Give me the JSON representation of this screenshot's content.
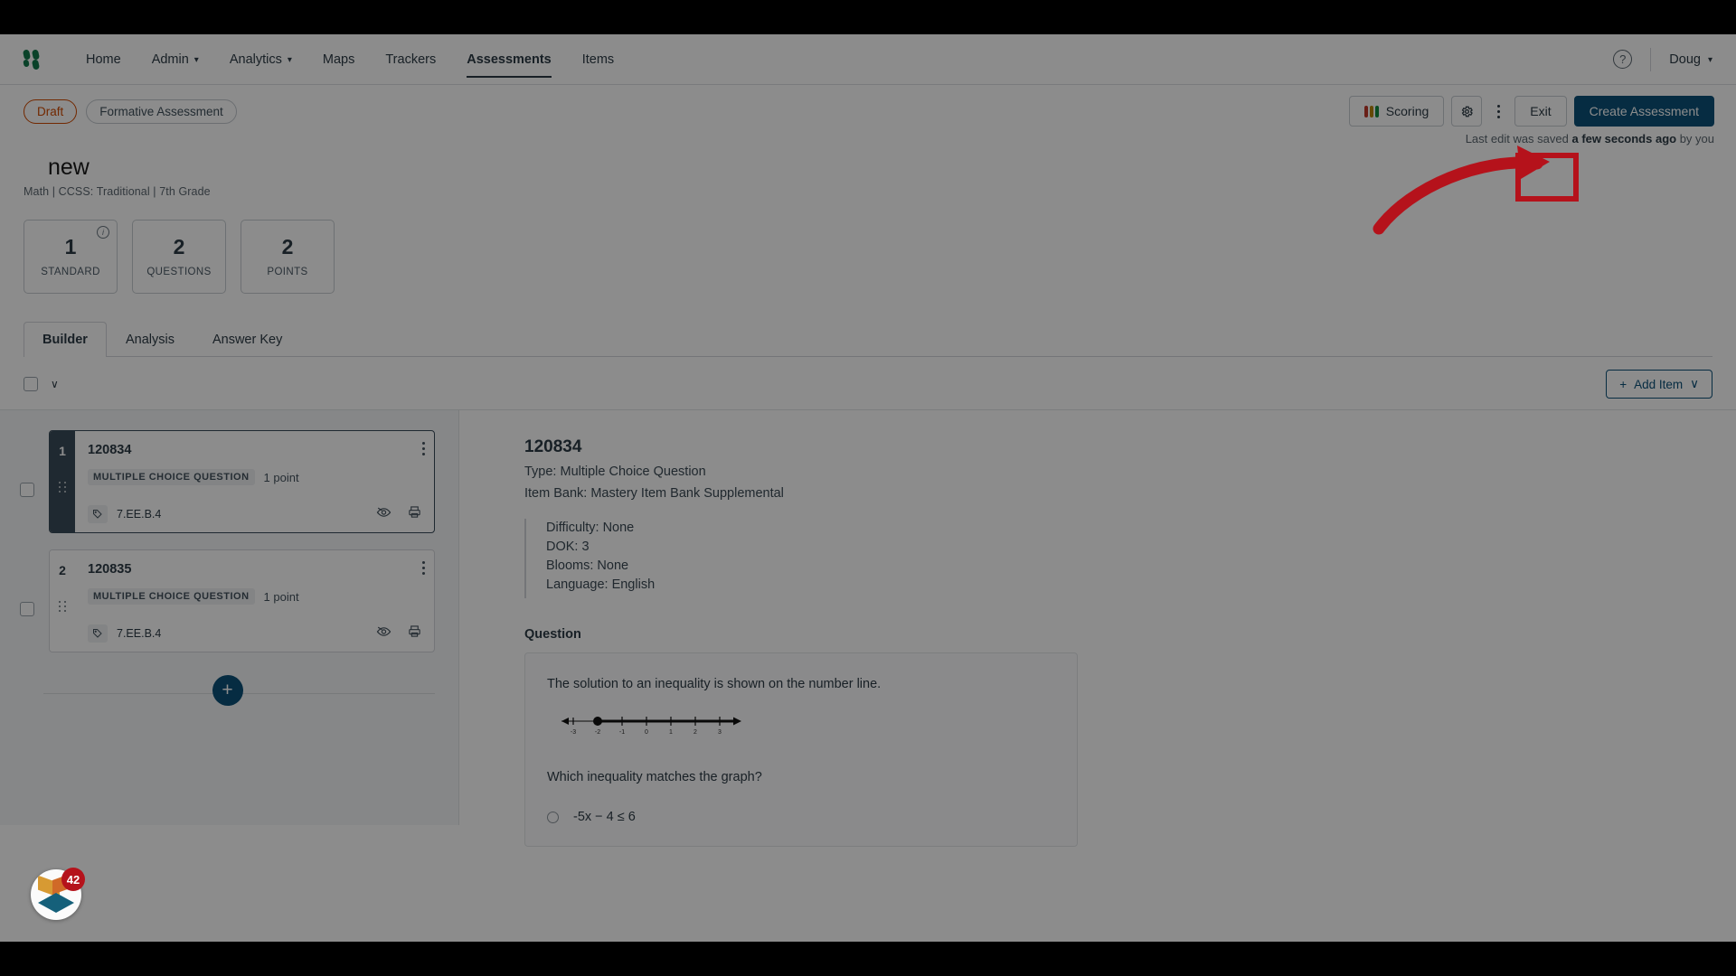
{
  "colors": {
    "accent": "#0b5078",
    "annotation": "#b5121b",
    "draft": "#cf4a00",
    "brand_green": "#13784b",
    "seal_purple": "#a3238e",
    "dark_rail": "#394b59"
  },
  "topnav": {
    "logo_name": "mastery-logo",
    "items": [
      {
        "label": "Home",
        "has_caret": false,
        "active": false
      },
      {
        "label": "Admin",
        "has_caret": true,
        "active": false
      },
      {
        "label": "Analytics",
        "has_caret": true,
        "active": false
      },
      {
        "label": "Maps",
        "has_caret": false,
        "active": false
      },
      {
        "label": "Trackers",
        "has_caret": false,
        "active": false
      },
      {
        "label": "Assessments",
        "has_caret": false,
        "active": true
      },
      {
        "label": "Items",
        "has_caret": false,
        "active": false
      }
    ],
    "help_label": "?",
    "user_label": "Doug",
    "user_caret": "∨"
  },
  "header": {
    "chips": [
      {
        "label": "Draft",
        "style": "draft"
      },
      {
        "label": "Formative Assessment",
        "style": "plain"
      }
    ],
    "actions": {
      "scoring_label": "Scoring",
      "settings_icon": "gear-icon",
      "kebab_icon": "more-vertical-icon",
      "exit_label": "Exit",
      "create_label": "Create Assessment"
    },
    "saved_prefix": "Last edit was saved ",
    "saved_strong": "a few seconds ago",
    "saved_suffix": " by you",
    "title": "new",
    "title_badge_icon": "verified-seal-icon",
    "subtitle": "Math  |  CCSS: Traditional  |  7th Grade"
  },
  "stats": [
    {
      "num": "1",
      "label": "STANDARD",
      "info": true,
      "info_icon": "info-icon"
    },
    {
      "num": "2",
      "label": "QUESTIONS",
      "info": false
    },
    {
      "num": "2",
      "label": "POINTS",
      "info": false
    }
  ],
  "tabs": [
    {
      "label": "Builder",
      "active": true
    },
    {
      "label": "Analysis",
      "active": false
    },
    {
      "label": "Answer Key",
      "active": false
    }
  ],
  "list_toolbar": {
    "select_all_checked": false,
    "chevron": "∨",
    "add_item_label": "Add Item",
    "add_item_plus": "+",
    "add_item_caret": "∨"
  },
  "items": [
    {
      "number": "1",
      "id": "120834",
      "type_label": "MULTIPLE CHOICE QUESTION",
      "points": "1 point",
      "standard": "7.EE.B.4",
      "selected": true,
      "tag_icon": "tag-icon",
      "preview_icon": "eye-off-icon",
      "print_icon": "printer-icon",
      "kebab_icon": "more-vertical-icon"
    },
    {
      "number": "2",
      "id": "120835",
      "type_label": "MULTIPLE CHOICE QUESTION",
      "points": "1 point",
      "standard": "7.EE.B.4",
      "selected": false,
      "tag_icon": "tag-icon",
      "preview_icon": "eye-off-icon",
      "print_icon": "printer-icon",
      "kebab_icon": "more-vertical-icon"
    }
  ],
  "add_inline": {
    "plus": "+"
  },
  "detail": {
    "item_id": "120834",
    "type_line": "Type: Multiple Choice Question",
    "bank_line": "Item Bank: Mastery Item Bank Supplemental",
    "meta": [
      "Difficulty: None",
      "DOK: 3",
      "Blooms: None",
      "Language: English"
    ],
    "question_heading": "Question",
    "stem": "The solution to an inequality is shown on the number line.",
    "numberline": {
      "ticks": [
        "-3",
        "-2",
        "-1",
        "0",
        "1",
        "2",
        "3"
      ],
      "closed_point": "-2",
      "direction": "right"
    },
    "prompt": "Which inequality matches the graph?",
    "choices": [
      {
        "label": "-5x − 4 ≤ 6",
        "selected": false
      }
    ]
  },
  "corner_widget": {
    "name": "mastery-connect-widget",
    "count": "42"
  },
  "annotation": {
    "highlight_target": "Exit",
    "arrow_color": "#b5121b"
  }
}
